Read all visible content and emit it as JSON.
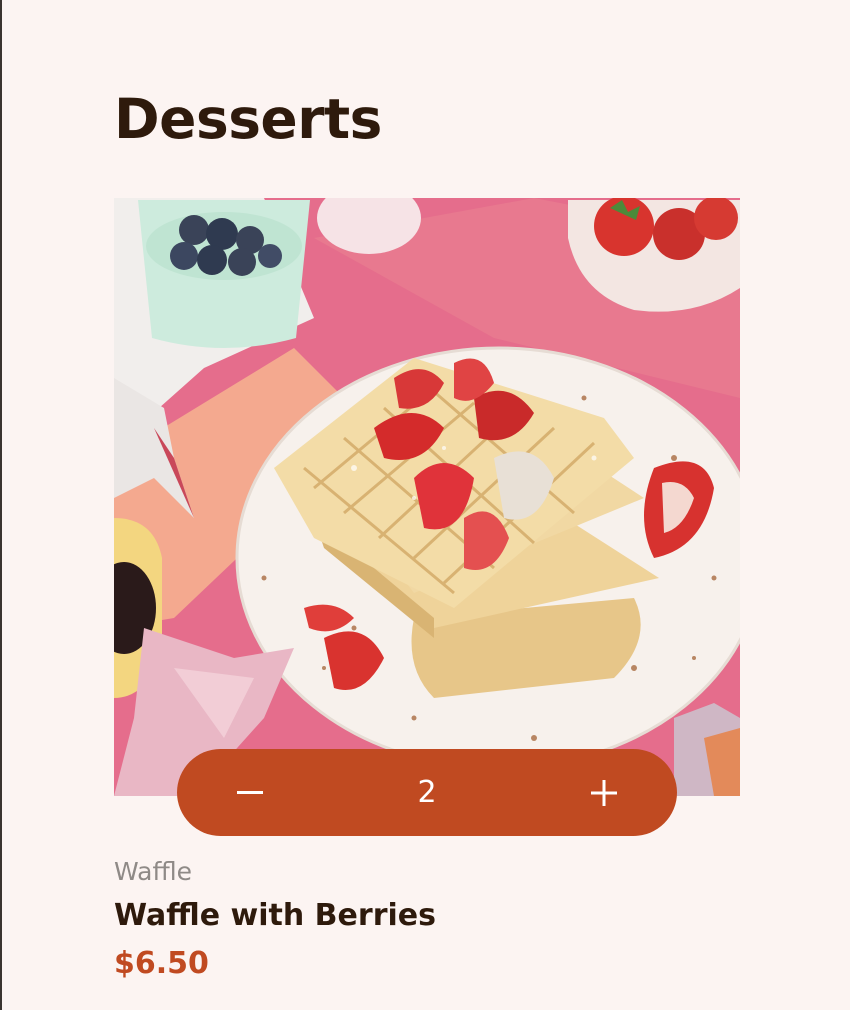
{
  "page": {
    "title": "Desserts"
  },
  "product": {
    "image_alt": "Stack of waffles topped with strawberries on a speckled plate",
    "category": "Waffle",
    "name": "Waffle with Berries",
    "price": "$6.50"
  },
  "cart": {
    "quantity": "2",
    "decrement_icon": "minus-icon",
    "increment_icon": "plus-icon"
  },
  "colors": {
    "background": "#FCF4F2",
    "heading": "#2E1A0C",
    "accent": "#C04A21",
    "muted": "#8F8A87"
  }
}
